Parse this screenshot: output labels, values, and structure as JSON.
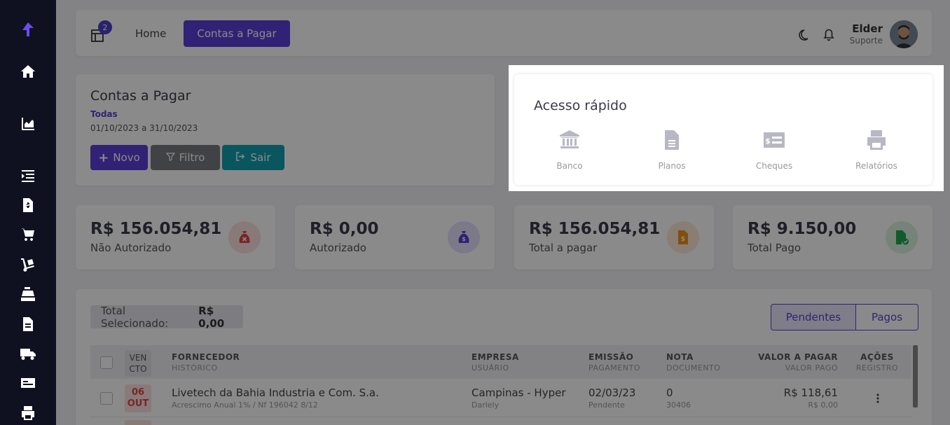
{
  "sidebar": {
    "logo": "brand-logo-icon",
    "items": [
      {
        "icon": "home-icon"
      },
      {
        "icon": "chart-icon"
      },
      {
        "icon": "list-indent-icon"
      },
      {
        "icon": "invoice-dollar-icon"
      },
      {
        "icon": "cart-plus-icon"
      },
      {
        "icon": "dolly-icon"
      },
      {
        "icon": "cash-register-icon"
      },
      {
        "icon": "file-icon"
      },
      {
        "icon": "truck-icon"
      },
      {
        "icon": "id-card-icon"
      },
      {
        "icon": "printer-icon"
      }
    ]
  },
  "topbar": {
    "badge_count": "2",
    "home": "Home",
    "active_nav": "Contas a Pagar",
    "user_name": "Elder",
    "user_role": "Suporte"
  },
  "header": {
    "title": "Contas a Pagar",
    "filter_label": "Todas",
    "date_range": "01/10/2023 a 31/10/2023",
    "btn_novo": "Novo",
    "btn_filtro": "Filtro",
    "btn_sair": "Sair"
  },
  "quick_access": {
    "title": "Acesso rápido",
    "items": [
      {
        "label": "Banco",
        "icon": "bank-icon"
      },
      {
        "label": "Planos",
        "icon": "file-text-icon"
      },
      {
        "label": "Cheques",
        "icon": "money-check-icon"
      },
      {
        "label": "Relatórios",
        "icon": "printer-icon"
      }
    ]
  },
  "stats": [
    {
      "value": "R$ 156.054,81",
      "label": "Não Autorizado",
      "icon": "money-bag-x-icon",
      "color": "#e24545"
    },
    {
      "value": "R$ 0,00",
      "label": "Autorizado",
      "icon": "money-bag-dollar-icon",
      "color": "#5b3fd8"
    },
    {
      "value": "R$ 156.054,81",
      "label": "Total a pagar",
      "icon": "invoice-dollar-icon",
      "color": "#f0901a"
    },
    {
      "value": "R$ 9.150,00",
      "label": "Total Pago",
      "icon": "file-check-icon",
      "color": "#22a650"
    }
  ],
  "table": {
    "selected_label": "Total Selecionado:",
    "selected_value": "R$ 0,00",
    "tab_pendentes": "Pendentes",
    "tab_pagos": "Pagos",
    "columns": {
      "venc_1": "VEN",
      "venc_2": "CTO",
      "fornecedor": "FORNECEDOR",
      "historico": "HISTÓRICO",
      "empresa": "EMPRESA",
      "usuario": "USUÁRIO",
      "emissao": "EMISSÃO",
      "pagamento": "PAGAMENTO",
      "nota": "NOTA",
      "documento": "DOCUMENTO",
      "valor_pagar": "VALOR A PAGAR",
      "valor_pago": "VALOR PAGO",
      "acoes": "AÇÕES",
      "registro": "REGISTRO"
    },
    "rows": [
      {
        "day": "06",
        "month": "OUT",
        "fornecedor": "Livetech da Bahia Industria e Com. S.a.",
        "historico": "Acrescimo Anual 1% / Nf 196042 8/12",
        "empresa": "Campinas - Hyper",
        "usuario": "Darlely",
        "emissao": "02/03/23",
        "pagamento": "Pendente",
        "nota": "0",
        "documento": "30406",
        "valor_pagar": "R$ 118,61",
        "valor_pago": "R$ 0,00"
      }
    ]
  }
}
